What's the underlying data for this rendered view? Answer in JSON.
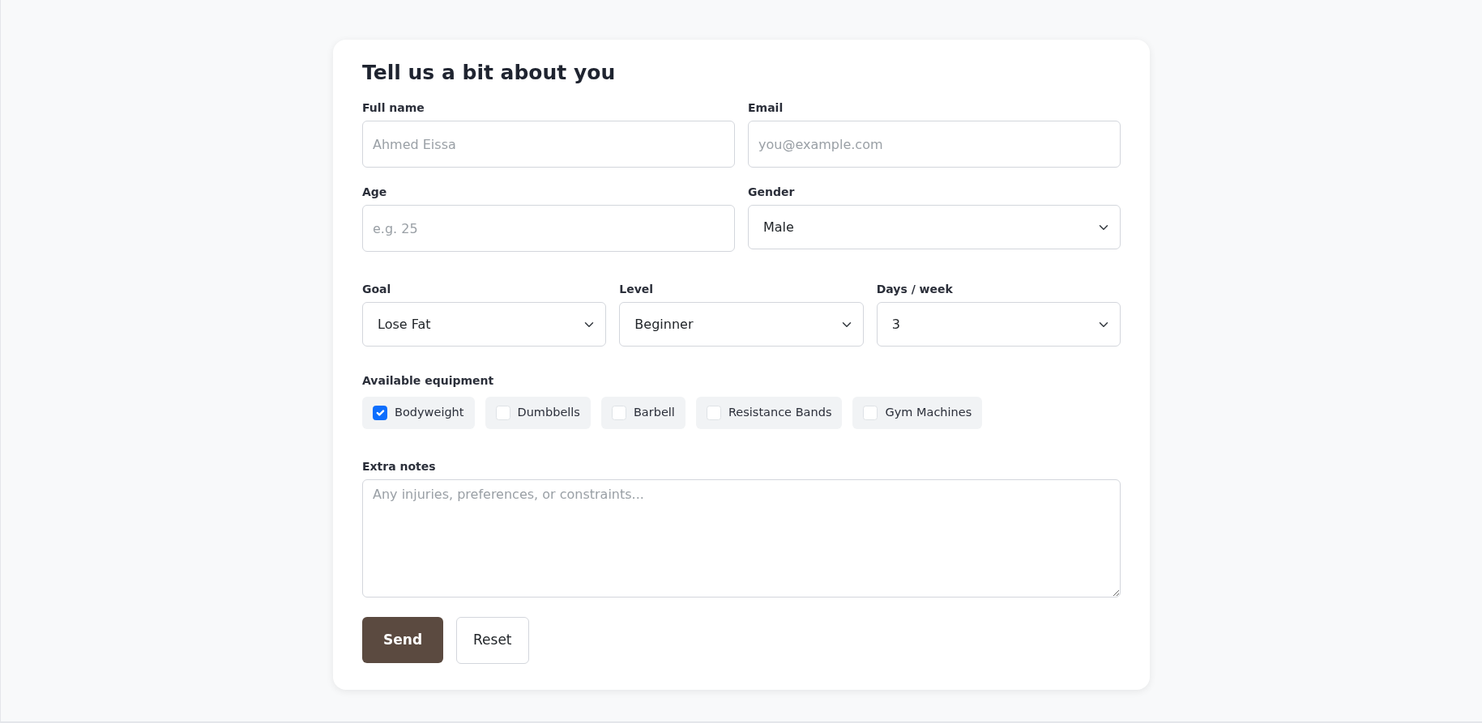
{
  "title": "Tell us a bit about you",
  "rows": [
    [
      {
        "label": "Full name",
        "kind": "text",
        "placeholder": "Ahmed Eissa"
      },
      {
        "label": "Email",
        "kind": "text",
        "placeholder": "you@example.com"
      }
    ],
    [
      {
        "label": "Age",
        "kind": "text",
        "placeholder": "e.g. 25"
      },
      {
        "label": "Gender",
        "kind": "select",
        "value": "Male"
      }
    ],
    [
      {
        "label": "Goal",
        "kind": "select",
        "value": "Lose Fat"
      },
      {
        "label": "Level",
        "kind": "select",
        "value": "Beginner"
      },
      {
        "label": "Days / week",
        "kind": "select",
        "value": "3"
      }
    ]
  ],
  "equipment": {
    "label": "Available equipment",
    "options": [
      {
        "label": "Bodyweight",
        "checked": true
      },
      {
        "label": "Dumbbells",
        "checked": false
      },
      {
        "label": "Barbell",
        "checked": false
      },
      {
        "label": "Resistance Bands",
        "checked": false
      },
      {
        "label": "Gym Machines",
        "checked": false
      }
    ]
  },
  "notes": {
    "label": "Extra notes",
    "placeholder": "Any injuries, preferences, or constraints..."
  },
  "buttons": [
    {
      "label": "Send",
      "kind": "primary"
    },
    {
      "label": "Reset",
      "kind": "secondary"
    }
  ]
}
